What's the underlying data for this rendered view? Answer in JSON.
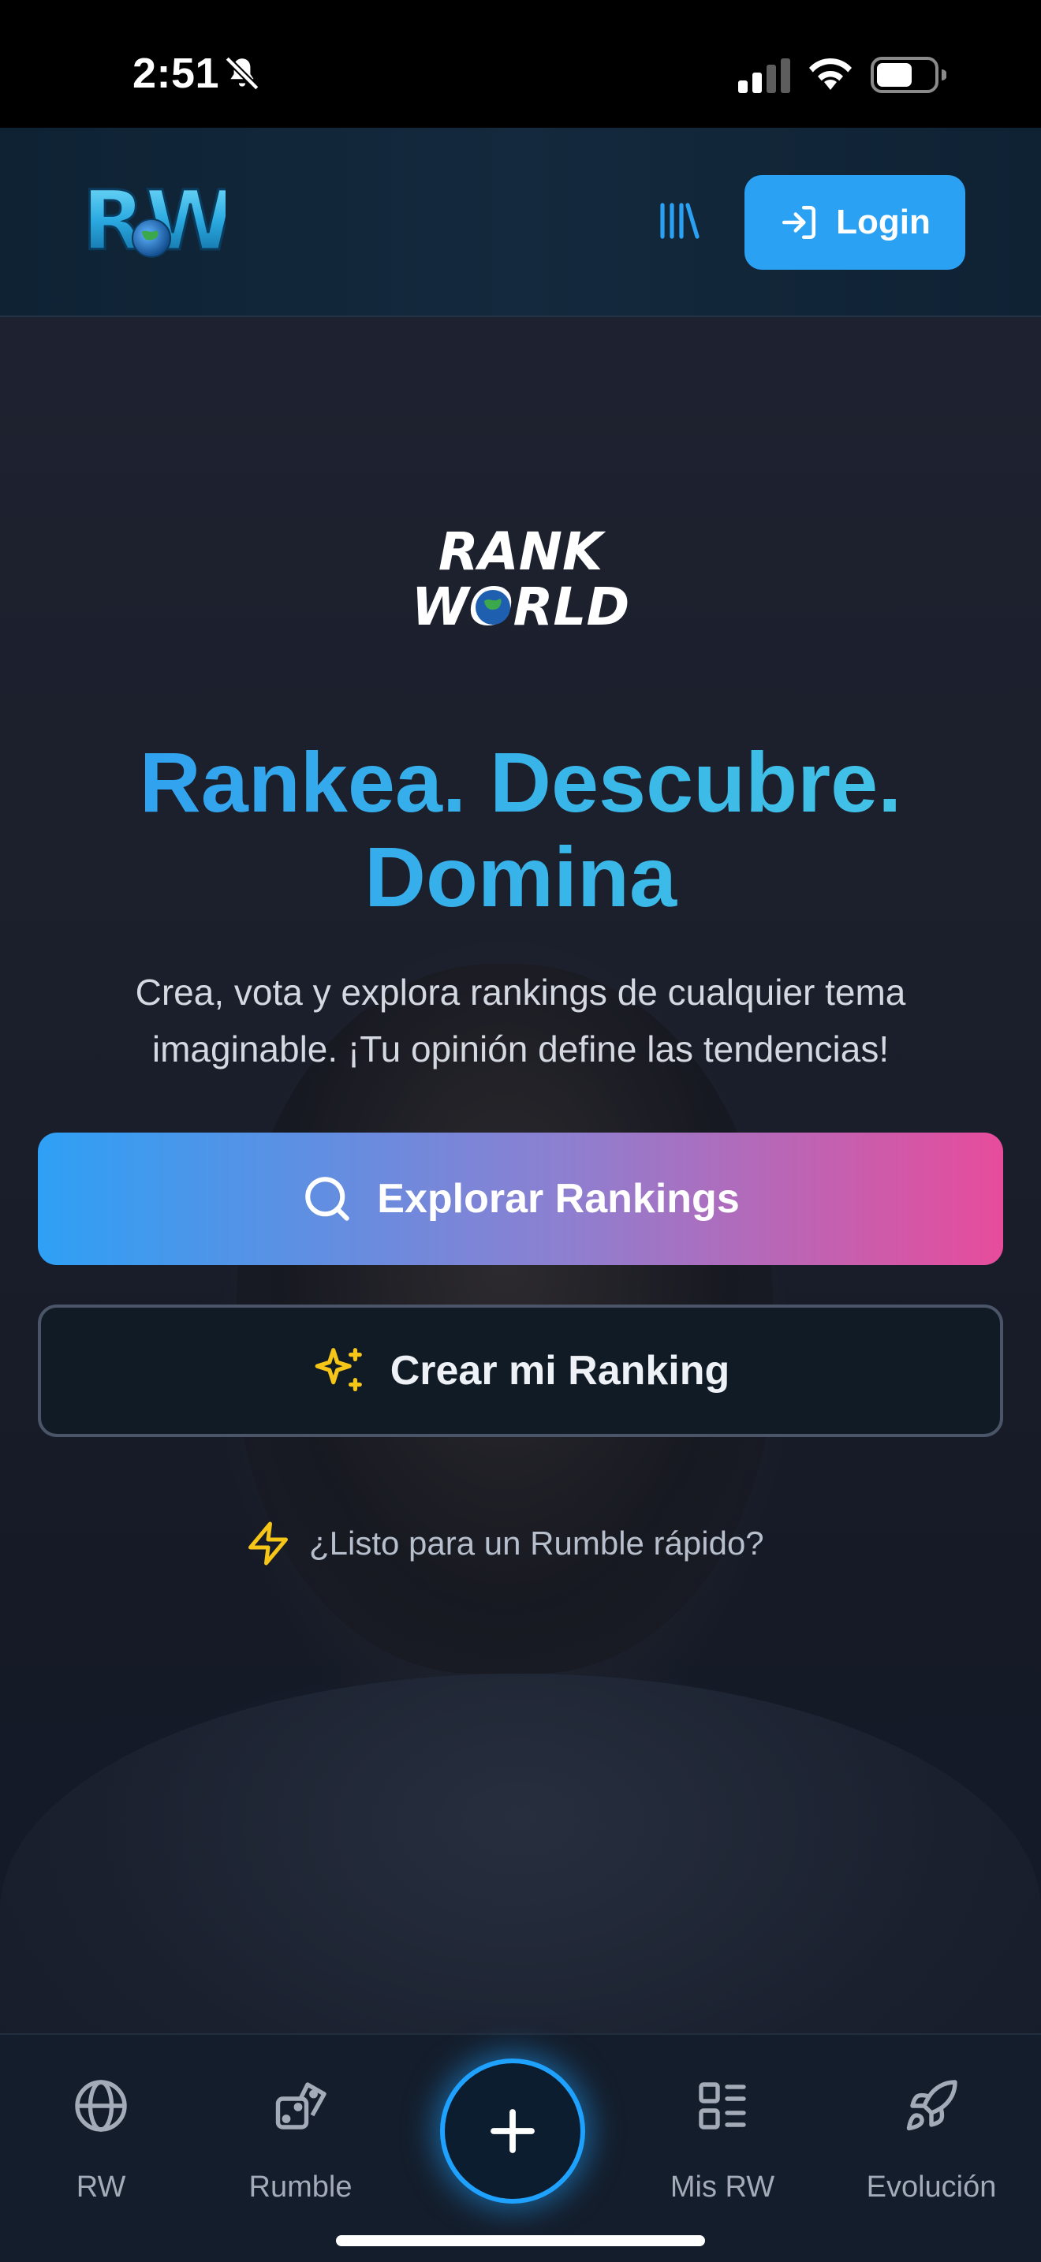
{
  "status_bar": {
    "time": "2:51",
    "icons": [
      "bell-slash-icon",
      "cellular-signal-icon",
      "wifi-icon",
      "battery-icon"
    ]
  },
  "header": {
    "logo_text": "RW",
    "library_icon": "library-icon",
    "login_label": "Login",
    "login_icon": "login-icon"
  },
  "hero": {
    "logo_line1": "RANK",
    "logo_line2": "WORLD",
    "title": "Rankea. Descubre. Domina",
    "subtitle": "Crea, vota y explora rankings de cualquier tema imaginable. ¡Tu opinión define las tendencias!",
    "explore_label": "Explorar Rankings",
    "create_label": "Crear mi Ranking",
    "rumble_prompt": "¿Listo para un Rumble rápido?"
  },
  "bottom_nav": {
    "items": [
      {
        "label": "RW",
        "icon": "globe-icon"
      },
      {
        "label": "Rumble",
        "icon": "dice-icon"
      },
      {
        "label": "Mis RW",
        "icon": "list-icon"
      },
      {
        "label": "Evolución",
        "icon": "rocket-icon"
      }
    ],
    "fab_icon": "plus-icon"
  },
  "colors": {
    "accent_blue": "#2aa1f3",
    "gradient_pink": "#e74c9b",
    "spark_yellow": "#f5c518"
  }
}
